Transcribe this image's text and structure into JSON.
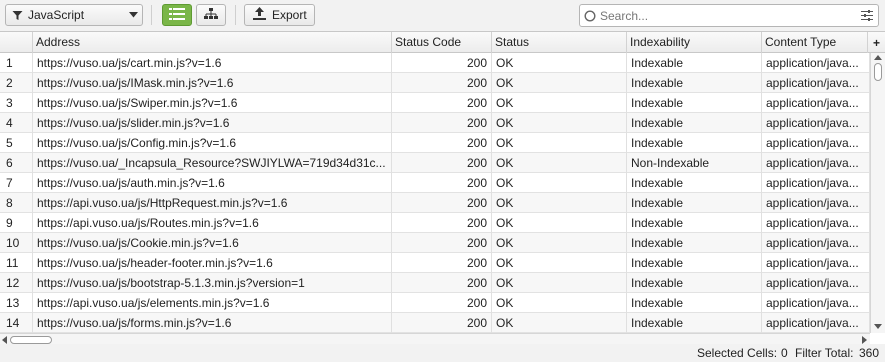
{
  "toolbar": {
    "filter_label": "JavaScript",
    "export_label": "Export",
    "search_placeholder": "Search...",
    "accent_color": "#7ab648"
  },
  "columns": [
    {
      "label": ""
    },
    {
      "label": "Address"
    },
    {
      "label": "Status Code"
    },
    {
      "label": "Status"
    },
    {
      "label": "Indexability"
    },
    {
      "label": "Content Type"
    }
  ],
  "rows": [
    {
      "n": "1",
      "address": "https://vuso.ua/js/cart.min.js?v=1.6",
      "code": "200",
      "status": "OK",
      "indexability": "Indexable",
      "type": "application/java..."
    },
    {
      "n": "2",
      "address": "https://vuso.ua/js/IMask.min.js?v=1.6",
      "code": "200",
      "status": "OK",
      "indexability": "Indexable",
      "type": "application/java..."
    },
    {
      "n": "3",
      "address": "https://vuso.ua/js/Swiper.min.js?v=1.6",
      "code": "200",
      "status": "OK",
      "indexability": "Indexable",
      "type": "application/java..."
    },
    {
      "n": "4",
      "address": "https://vuso.ua/js/slider.min.js?v=1.6",
      "code": "200",
      "status": "OK",
      "indexability": "Indexable",
      "type": "application/java..."
    },
    {
      "n": "5",
      "address": "https://vuso.ua/js/Config.min.js?v=1.6",
      "code": "200",
      "status": "OK",
      "indexability": "Indexable",
      "type": "application/java..."
    },
    {
      "n": "6",
      "address": "https://vuso.ua/_Incapsula_Resource?SWJIYLWA=719d34d31c...",
      "code": "200",
      "status": "OK",
      "indexability": "Non-Indexable",
      "type": "application/java..."
    },
    {
      "n": "7",
      "address": "https://vuso.ua/js/auth.min.js?v=1.6",
      "code": "200",
      "status": "OK",
      "indexability": "Indexable",
      "type": "application/java..."
    },
    {
      "n": "8",
      "address": "https://api.vuso.ua/js/HttpRequest.min.js?v=1.6",
      "code": "200",
      "status": "OK",
      "indexability": "Indexable",
      "type": "application/java..."
    },
    {
      "n": "9",
      "address": "https://api.vuso.ua/js/Routes.min.js?v=1.6",
      "code": "200",
      "status": "OK",
      "indexability": "Indexable",
      "type": "application/java..."
    },
    {
      "n": "10",
      "address": "https://vuso.ua/js/Cookie.min.js?v=1.6",
      "code": "200",
      "status": "OK",
      "indexability": "Indexable",
      "type": "application/java..."
    },
    {
      "n": "11",
      "address": "https://vuso.ua/js/header-footer.min.js?v=1.6",
      "code": "200",
      "status": "OK",
      "indexability": "Indexable",
      "type": "application/java..."
    },
    {
      "n": "12",
      "address": "https://vuso.ua/js/bootstrap-5.1.3.min.js?version=1",
      "code": "200",
      "status": "OK",
      "indexability": "Indexable",
      "type": "application/java..."
    },
    {
      "n": "13",
      "address": "https://api.vuso.ua/js/elements.min.js?v=1.6",
      "code": "200",
      "status": "OK",
      "indexability": "Indexable",
      "type": "application/java..."
    },
    {
      "n": "14",
      "address": "https://vuso.ua/js/forms.min.js?v=1.6",
      "code": "200",
      "status": "OK",
      "indexability": "Indexable",
      "type": "application/java..."
    }
  ],
  "statusbar": {
    "selected_label": "Selected Cells:",
    "selected_value": "0",
    "filter_label": "Filter Total:",
    "filter_value": "360"
  }
}
